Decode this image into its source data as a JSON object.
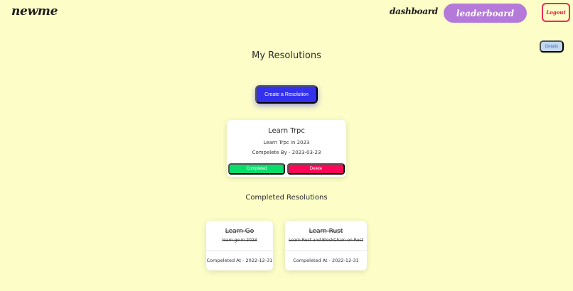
{
  "header": {
    "brand": "newme",
    "nav": {
      "dashboard": "dashboard",
      "leaderboard": "leaderboard",
      "logout": "Logout"
    }
  },
  "details_label": "Details",
  "page_title": "My Resolutions",
  "create_label": "Create a Resolution",
  "active_resolutions": [
    {
      "title": "Learn Trpc",
      "description": "Learn Trpc in 2023",
      "due": "Compelete By - 2023-03-23",
      "completed_label": "Completed",
      "delete_label": "Delete"
    }
  ],
  "completed_section_title": "Completed Resolutions",
  "completed_resolutions": [
    {
      "title": "Learn Go",
      "description": "learn go in 2023",
      "completed_at": "Compeleted At - 2022-12-31"
    },
    {
      "title": "Learn Rust",
      "description": "Learn Rust and BlockChain on Rust",
      "completed_at": "Compeleted At - 2022-12-31"
    }
  ],
  "colors": {
    "background": "#fcfdc7",
    "leaderboard": "#b57ad9",
    "logout_border": "#ee2b56",
    "primary": "#3330ee",
    "success": "#08dd6a",
    "danger": "#ff0758",
    "details_bg": "#c3d7ef"
  }
}
